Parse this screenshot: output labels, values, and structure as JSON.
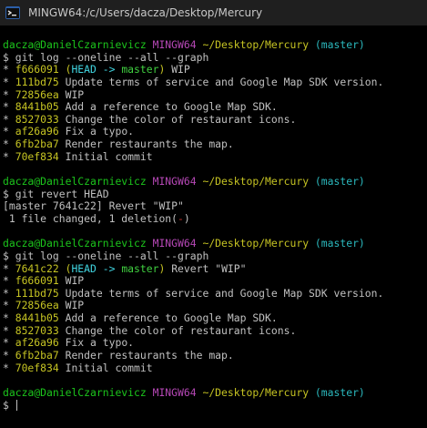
{
  "window": {
    "title": "MINGW64:/c/Users/dacza/Desktop/Mercury",
    "icon": "mingw-terminal-icon"
  },
  "colors": {
    "background": "#000000",
    "text": "#c0c0c0",
    "user": "#1cc51c",
    "system": "#b648b6",
    "path": "#c6c423",
    "branch": "#2bb8bd",
    "head": "#41d6e2",
    "branch_ref": "#40d040",
    "hash": "#c6c423",
    "deletions": "#c8342e"
  },
  "prompt": {
    "user": "dacza@DanielCzarnievicz",
    "system": "MINGW64",
    "path": "~/Desktop/Mercury",
    "branch": "(master)"
  },
  "session": {
    "cmd1": "$ git log --oneline --all --graph",
    "log1": [
      {
        "hash": "f666091",
        "head": "HEAD -> ",
        "ref": "master",
        "msg": "WIP"
      },
      {
        "hash": "111bd75",
        "msg": "Update terms of service and Google Map SDK version."
      },
      {
        "hash": "72856ea",
        "msg": "WIP"
      },
      {
        "hash": "8441b05",
        "msg": "Add a reference to Google Map SDK."
      },
      {
        "hash": "8527033",
        "msg": "Change the color of restaurant icons."
      },
      {
        "hash": "af26a96",
        "msg": "Fix a typo."
      },
      {
        "hash": "6fb2ba7",
        "msg": "Render restaurants the map."
      },
      {
        "hash": "70ef834",
        "msg": "Initial commit"
      }
    ],
    "cmd2": "$ git revert HEAD",
    "revert_result": "[master 7641c22] Revert \"WIP\"",
    "revert_stats_prefix": " 1 file changed, 1 deletion",
    "revert_stats_minus": "-",
    "cmd3": "$ git log --oneline --all --graph",
    "log2": [
      {
        "hash": "7641c22",
        "head": "HEAD -> ",
        "ref": "master",
        "msg": "Revert \"WIP\""
      },
      {
        "hash": "f666091",
        "msg": "WIP"
      },
      {
        "hash": "111bd75",
        "msg": "Update terms of service and Google Map SDK version."
      },
      {
        "hash": "72856ea",
        "msg": "WIP"
      },
      {
        "hash": "8441b05",
        "msg": "Add a reference to Google Map SDK."
      },
      {
        "hash": "8527033",
        "msg": "Change the color of restaurant icons."
      },
      {
        "hash": "af26a96",
        "msg": "Fix a typo."
      },
      {
        "hash": "6fb2ba7",
        "msg": "Render restaurants the map."
      },
      {
        "hash": "70ef834",
        "msg": "Initial commit"
      }
    ],
    "final_prompt_symbol": "$ "
  }
}
